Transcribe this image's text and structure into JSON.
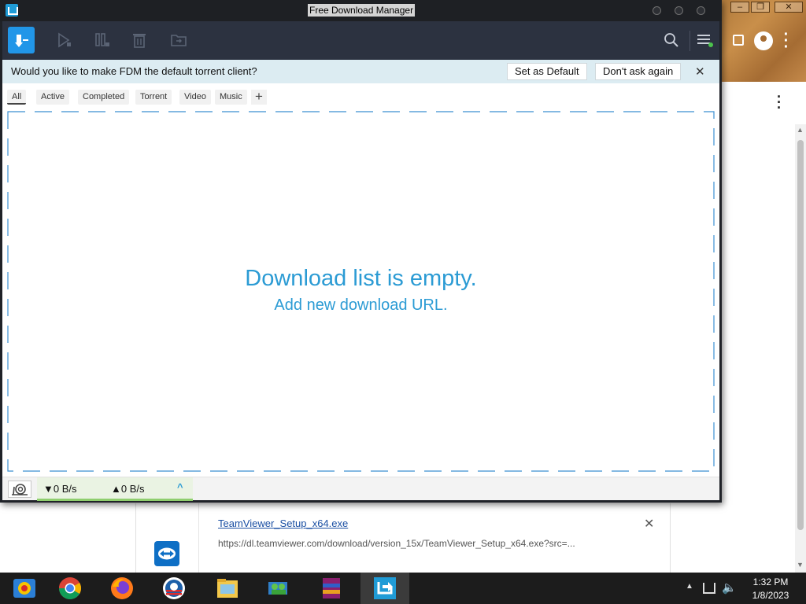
{
  "fdm": {
    "title": "Free Download Manager",
    "notification": {
      "text": "Would you like to make FDM the default torrent client?",
      "set_default_label": "Set as Default",
      "dont_ask_label": "Don't ask again",
      "close_glyph": "✕"
    },
    "tabs": [
      "All",
      "Active",
      "Completed",
      "Torrent",
      "Video",
      "Music"
    ],
    "tab_add_glyph": "+",
    "selected_tab": "All",
    "empty": {
      "title": "Download list is empty.",
      "subtitle": "Add new download URL."
    },
    "status": {
      "download_speed": "▼0 B/s",
      "upload_speed": "▲0 B/s",
      "expand_glyph": "^"
    },
    "toolbar_icons": [
      "add-download-icon",
      "resume-icon",
      "pause-icon",
      "delete-icon",
      "move-icon",
      "search-icon",
      "menu-icon"
    ],
    "accent_color": "#2196e8"
  },
  "browser_download": {
    "filename": "TeamViewer_Setup_x64.exe",
    "url": "https://dl.teamviewer.com/download/version_15x/TeamViewer_Setup_x64.exe?src=...",
    "close_glyph": "✕"
  },
  "taskbar": {
    "time": "1:32 PM",
    "date": "1/8/2023",
    "apps": [
      "screen-recorder-icon",
      "chrome-icon",
      "firefox-icon",
      "obama-campaign-icon",
      "file-explorer-icon",
      "network-people-icon",
      "winrar-icon",
      "free-download-manager-icon"
    ]
  }
}
